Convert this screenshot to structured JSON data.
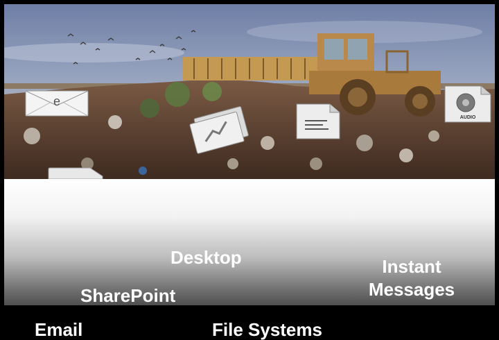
{
  "labels": {
    "desktop": "Desktop",
    "sharepoint": "SharePoint",
    "instant_line1": "Instant",
    "instant_line2": "Messages",
    "email": "Email",
    "file_systems": "File Systems"
  },
  "icons": {
    "email": "email-envelope-icon",
    "chart": "chart-document-icon",
    "doc": "text-document-icon",
    "audio": "audio-file-icon",
    "audio_text": "AUDIO",
    "email_glyph": "e"
  },
  "colors": {
    "sky_top": "#6f7fa6",
    "sky_bottom": "#e6c49a",
    "ground": "#5a3a28",
    "bulldozer": "#c49a52",
    "text": "#ffffff",
    "background_bar": "#000000"
  }
}
